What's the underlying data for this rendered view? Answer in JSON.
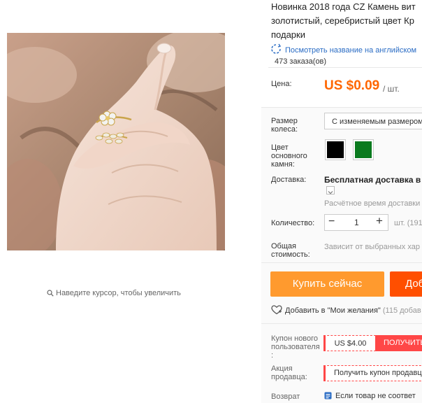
{
  "product": {
    "title_lines": [
      "Новинка 2018 года CZ Камень вит",
      "золотистый, серебристый цвет Кр",
      "подарки"
    ],
    "translate_link": "Посмотреть название на английском",
    "orders": "473 заказа(ов)"
  },
  "gallery": {
    "zoom_hint": "Наведите курсор, чтобы увеличить"
  },
  "price": {
    "label": "Цена:",
    "value": "US $0.09",
    "unit": "/ шт."
  },
  "options": {
    "size_label": "Размер колеса:",
    "size_selected": "С изменяемым размером",
    "stone_label": "Цвет основного камня:",
    "stone_colors": [
      "#000000",
      "#0a7a1e"
    ]
  },
  "shipping": {
    "label": "Доставка:",
    "value": "Бесплатная доставка в Ru",
    "estimate": "Расчётное время доставки"
  },
  "quantity": {
    "label": "Количество:",
    "minus": "−",
    "value": "1",
    "plus": "+",
    "stock": "шт. (191"
  },
  "total": {
    "label": "Общая стоимость:",
    "value": "Зависит от выбранных хар"
  },
  "actions": {
    "buy_now": "Купить сейчас",
    "add_to_cart": "Доб",
    "wishlist": "Добавить в \"Мои желания\"",
    "wishlist_count": "(115 добав"
  },
  "coupon": {
    "label": "Купон нового пользователя :",
    "amount": "US $4.00",
    "get": "ПОЛУЧИТЬ"
  },
  "promo": {
    "label": "Акция продавца:",
    "button": "Получить купон продавц"
  },
  "returns": {
    "label": "Возврат",
    "value": "Если товар не соответ"
  },
  "colors": {
    "accent_orange": "#ff6600",
    "buy_button": "#ff9a2e",
    "cart_button": "#ff4f00",
    "coupon_red": "#ff4747",
    "link_blue": "#2a6cc4"
  }
}
